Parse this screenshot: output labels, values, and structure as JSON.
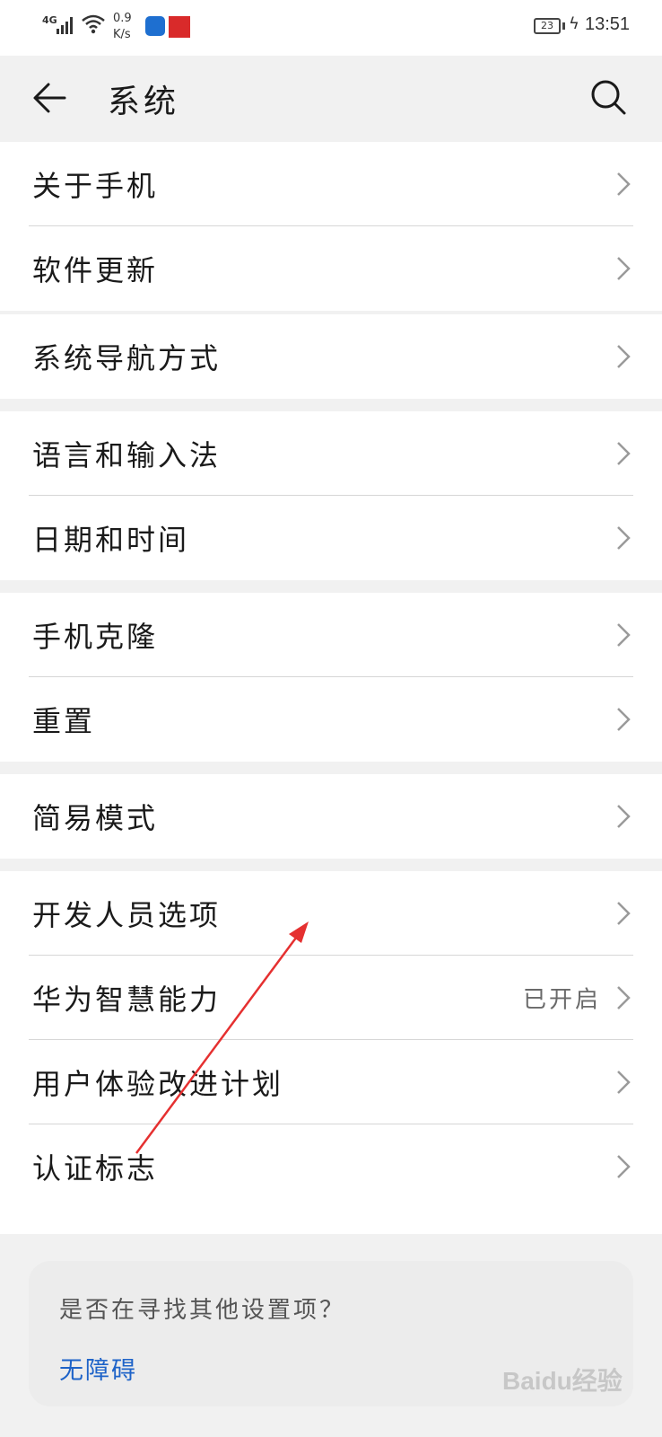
{
  "status_bar": {
    "network": "4G",
    "speed_value": "0.9",
    "speed_unit": "K/s",
    "battery": "23",
    "time": "13:51"
  },
  "header": {
    "title": "系统"
  },
  "groups": [
    {
      "items": [
        {
          "label": "关于手机"
        },
        {
          "label": "软件更新"
        }
      ]
    },
    {
      "items": [
        {
          "label": "系统导航方式"
        }
      ]
    },
    {
      "items": [
        {
          "label": "语言和输入法"
        },
        {
          "label": "日期和时间"
        }
      ]
    },
    {
      "items": [
        {
          "label": "手机克隆"
        },
        {
          "label": "重置"
        }
      ]
    },
    {
      "items": [
        {
          "label": "简易模式"
        }
      ]
    },
    {
      "items": [
        {
          "label": "开发人员选项"
        },
        {
          "label": "华为智慧能力",
          "value": "已开启"
        },
        {
          "label": "用户体验改进计划"
        },
        {
          "label": "认证标志"
        }
      ]
    }
  ],
  "bottom_card": {
    "question": "是否在寻找其他设置项？",
    "link": "无障碍"
  },
  "watermark": "Baidu经验",
  "colors": {
    "background": "#f1f1f1",
    "card": "#ffffff",
    "link": "#1e63c8",
    "annotation_arrow": "#e53030"
  }
}
